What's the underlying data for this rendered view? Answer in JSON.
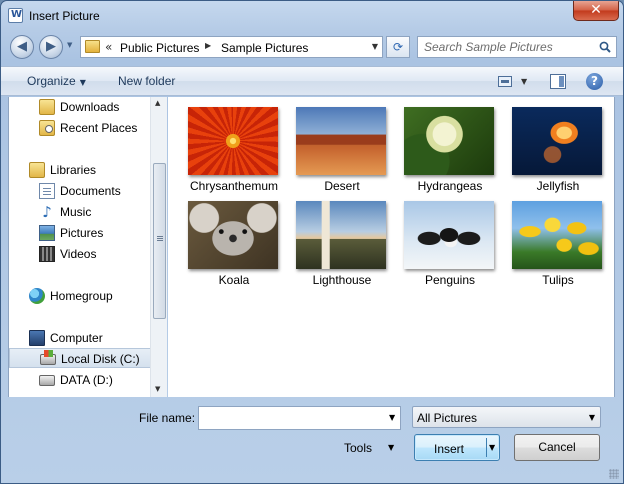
{
  "window": {
    "title": "Insert Picture",
    "close_glyph": "✕"
  },
  "address_bar": {
    "back_glyph": "◀",
    "forward_glyph": "▶",
    "nav_dropdown_glyph": "▼",
    "overflow_glyph": "«",
    "crumbs": [
      "Public Pictures",
      "Sample Pictures"
    ],
    "separator_glyph": "▶",
    "dropdown_glyph": "▼",
    "refresh_glyph": "⟳"
  },
  "search": {
    "placeholder": "Search Sample Pictures"
  },
  "toolbar": {
    "organize_label": "Organize",
    "organize_caret": "▼",
    "new_folder_label": "New folder",
    "views_caret": "▼",
    "help_glyph": "?"
  },
  "nav_pane": {
    "items": [
      {
        "label": "Downloads",
        "icon": "downloads-folder-icon"
      },
      {
        "label": "Recent Places",
        "icon": "recent-places-icon"
      },
      {
        "label": "Libraries",
        "icon": "libraries-icon"
      },
      {
        "label": "Documents",
        "icon": "documents-icon"
      },
      {
        "label": "Music",
        "icon": "music-icon"
      },
      {
        "label": "Pictures",
        "icon": "pictures-icon"
      },
      {
        "label": "Videos",
        "icon": "videos-icon"
      },
      {
        "label": "Homegroup",
        "icon": "homegroup-icon"
      },
      {
        "label": "Computer",
        "icon": "computer-icon"
      },
      {
        "label": "Local Disk (C:)",
        "icon": "local-disk-icon",
        "selected": true
      },
      {
        "label": "DATA (D:)",
        "icon": "drive-icon"
      }
    ],
    "scroll_up_glyph": "▲",
    "scroll_down_glyph": "▼"
  },
  "files": [
    {
      "name": "Chrysanthemum"
    },
    {
      "name": "Desert"
    },
    {
      "name": "Hydrangeas"
    },
    {
      "name": "Jellyfish"
    },
    {
      "name": "Koala"
    },
    {
      "name": "Lighthouse"
    },
    {
      "name": "Penguins"
    },
    {
      "name": "Tulips"
    }
  ],
  "footer": {
    "file_name_label": "File name:",
    "file_name_value": "",
    "file_name_dropdown_glyph": "▼",
    "filter_value": "All Pictures",
    "filter_dropdown_glyph": "▼",
    "tools_label": "Tools",
    "tools_caret": "▼",
    "insert_label": "Insert",
    "insert_caret": "▼",
    "cancel_label": "Cancel"
  },
  "colors": {
    "window_frame": "#b5cbe6",
    "accent_button": "#a7d9f5",
    "selection": "#d5e1ee"
  }
}
